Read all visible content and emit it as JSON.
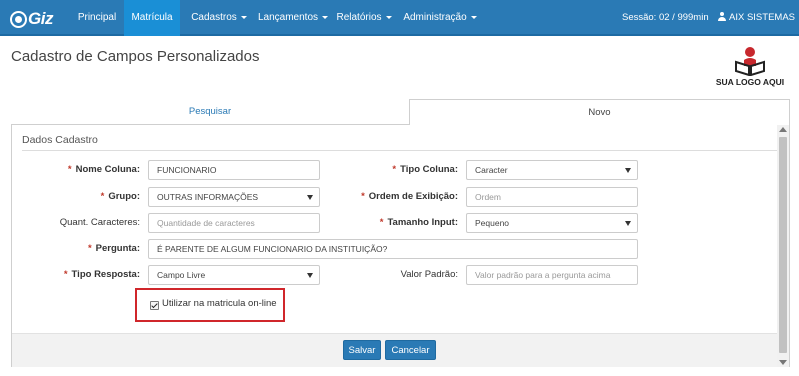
{
  "app": {
    "logo_text": "Giz",
    "logo_prefix": "u"
  },
  "nav": {
    "items": [
      {
        "label": "Principal"
      },
      {
        "label": "Matrícula"
      },
      {
        "label": "Cadastros"
      },
      {
        "label": "Lançamentos"
      },
      {
        "label": "Relatórios"
      },
      {
        "label": "Administração"
      }
    ],
    "active_item": "Matrícula",
    "session": "Sessão: 02 / 999min",
    "user": "AIX SISTEMAS"
  },
  "page": {
    "title": "Cadastro de Campos Personalizados",
    "brand_logo_text": "SUA LOGO AQUI"
  },
  "tabs": [
    {
      "label": "Pesquisar"
    },
    {
      "label": "Novo"
    }
  ],
  "active_tab": "Novo",
  "form": {
    "legend": "Dados Cadastro",
    "nome_coluna": {
      "label": "Nome Coluna:",
      "value": "FUNCIONARIO"
    },
    "tipo_coluna": {
      "label": "Tipo Coluna:",
      "value": "Caracter"
    },
    "grupo": {
      "label": "Grupo:",
      "value": "OUTRAS INFORMAÇÕES"
    },
    "ordem_exibicao": {
      "label": "Ordem de Exibição:",
      "placeholder": "Ordem"
    },
    "quant_caracteres": {
      "label": "Quant. Caracteres:",
      "placeholder": "Quantidade de caracteres"
    },
    "tamanho_input": {
      "label": "Tamanho Input:",
      "value": "Pequeno"
    },
    "pergunta": {
      "label": "Pergunta:",
      "value": "É PARENTE DE ALGUM FUNCIONARIO DA INSTITUIÇÃO?"
    },
    "tipo_resposta": {
      "label": "Tipo Resposta:",
      "value": "Campo Livre"
    },
    "valor_padrao": {
      "label": "Valor Padrão:",
      "placeholder": "Valor padrão para a pergunta acima"
    },
    "online": {
      "label": "Utilizar na matricula on-line",
      "checked": true
    }
  },
  "buttons": {
    "save": "Salvar",
    "cancel": "Cancelar"
  },
  "colors": {
    "primary": "#2a7ab5",
    "active_nav": "#1a8fd6",
    "highlight_border": "#d0262b",
    "required": "#c0392b"
  },
  "icons": [
    "user-icon",
    "caret-down-icon",
    "checkmark-icon",
    "book-reader-icon"
  ]
}
